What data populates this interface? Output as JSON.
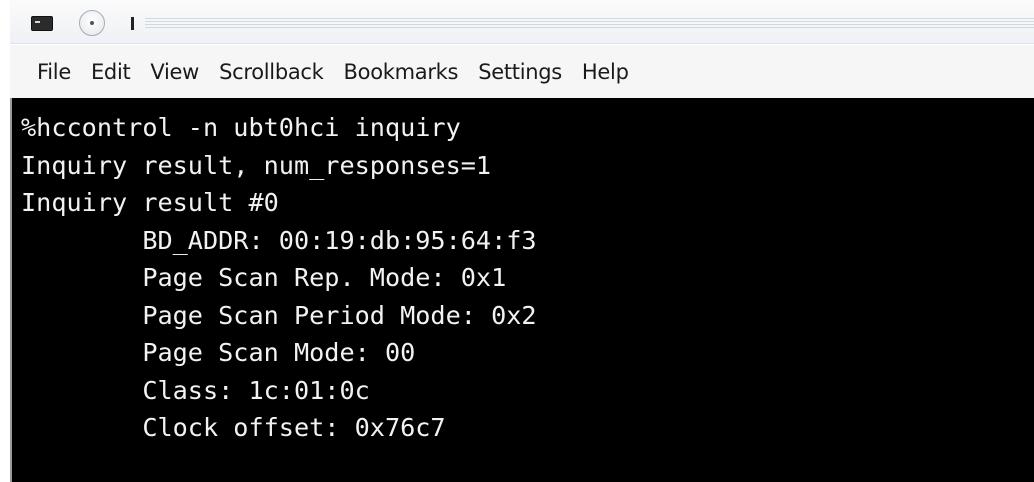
{
  "window": {
    "title": ""
  },
  "menu": {
    "items": [
      "File",
      "Edit",
      "View",
      "Scrollback",
      "Bookmarks",
      "Settings",
      "Help"
    ]
  },
  "terminal": {
    "lines": [
      "%hccontrol -n ubt0hci inquiry",
      "Inquiry result, num_responses=1",
      "Inquiry result #0",
      "        BD_ADDR: 00:19:db:95:64:f3",
      "        Page Scan Rep. Mode: 0x1",
      "        Page Scan Period Mode: 0x2",
      "        Page Scan Mode: 00",
      "        Class: 1c:01:0c",
      "        Clock offset: 0x76c7"
    ]
  }
}
